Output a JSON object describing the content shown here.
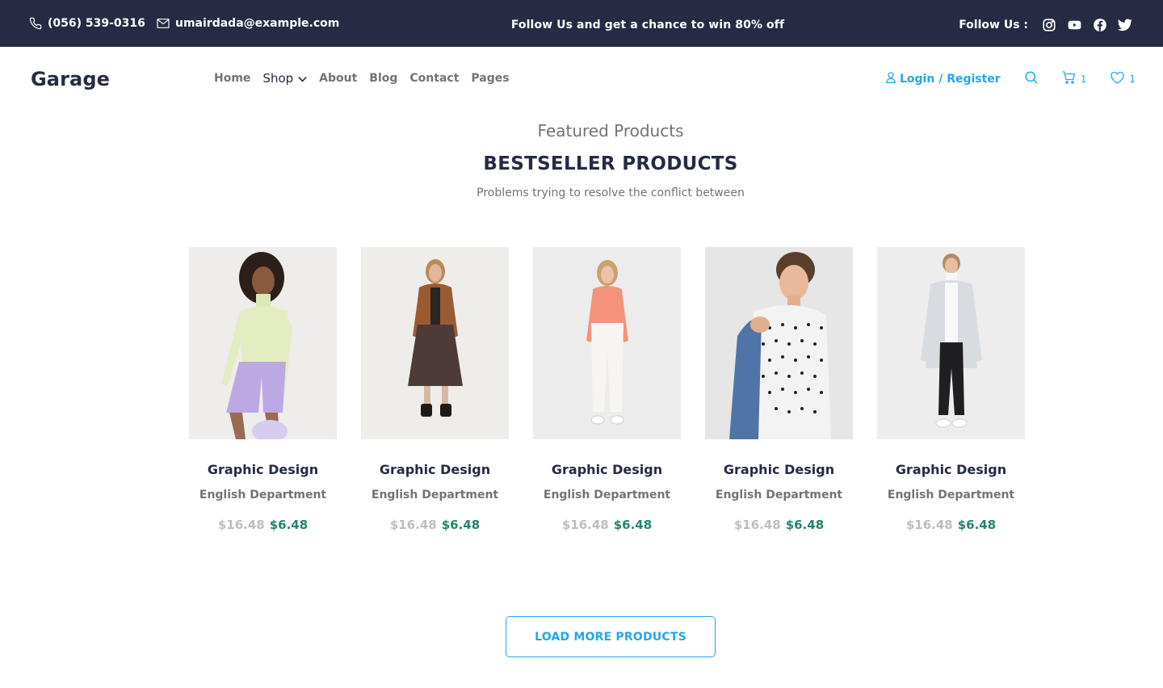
{
  "topbar": {
    "phone": "(056) 539-0316",
    "email": "umairdada@example.com",
    "promo": "Follow Us  and get a chance to win 80% off",
    "follow_label": "Follow Us  :",
    "social_icons": [
      "instagram-icon",
      "youtube-icon",
      "facebook-icon",
      "twitter-icon"
    ],
    "background": "#252B42"
  },
  "header": {
    "logo": "Garage",
    "nav": [
      "Home",
      "Shop",
      "About",
      "Blog",
      "Contact",
      "Pages"
    ],
    "login": "Login / Register",
    "cart_count": "1",
    "wishlist_count": "1",
    "accent": "#23A6F0"
  },
  "section": {
    "featured": "Featured Products",
    "title": "BESTSELLER PRODUCTS",
    "subtitle": "Problems trying to resolve the conflict between"
  },
  "products": [
    {
      "title": "Graphic Design",
      "dept": "English Department",
      "old_price": "$16.48",
      "new_price": "$6.48"
    },
    {
      "title": "Graphic Design",
      "dept": "English Department",
      "old_price": "$16.48",
      "new_price": "$6.48"
    },
    {
      "title": "Graphic Design",
      "dept": "English Department",
      "old_price": "$16.48",
      "new_price": "$6.48"
    },
    {
      "title": "Graphic Design",
      "dept": "English Department",
      "old_price": "$16.48",
      "new_price": "$6.48"
    },
    {
      "title": "Graphic Design",
      "dept": "English Department",
      "old_price": "$16.48",
      "new_price": "$6.48"
    }
  ],
  "load_more": "LOAD MORE PRODUCTS",
  "colors": {
    "price_new": "#23856D",
    "price_old": "#BDBDBD",
    "text_secondary": "#737373"
  }
}
